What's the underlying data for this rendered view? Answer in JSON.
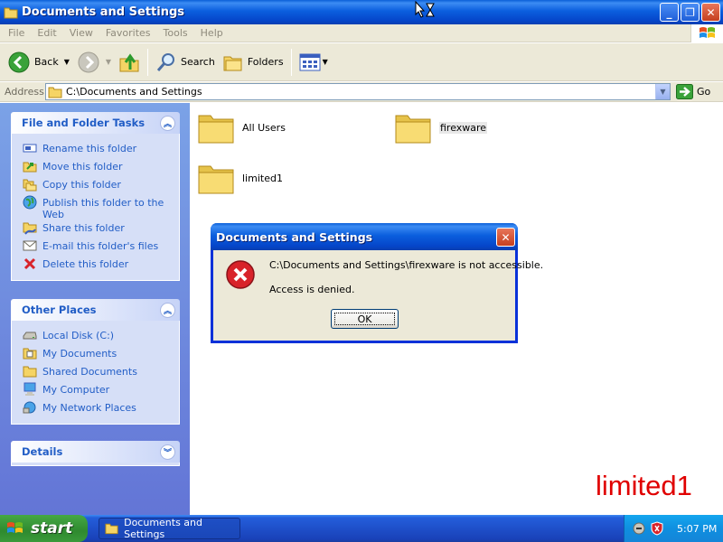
{
  "window": {
    "title": "Documents and Settings"
  },
  "menu": [
    "File",
    "Edit",
    "View",
    "Favorites",
    "Tools",
    "Help"
  ],
  "toolbar": {
    "back": "Back",
    "search": "Search",
    "folders": "Folders"
  },
  "address": {
    "label": "Address",
    "value": "C:\\Documents and Settings",
    "go": "Go"
  },
  "tasks_panel": {
    "title": "File and Folder Tasks",
    "items": [
      {
        "label": "Rename this folder",
        "icon": "rename-icon"
      },
      {
        "label": "Move this folder",
        "icon": "move-icon"
      },
      {
        "label": "Copy this folder",
        "icon": "copy-icon"
      },
      {
        "label": "Publish this folder to the Web",
        "icon": "globe-icon"
      },
      {
        "label": "Share this folder",
        "icon": "share-icon"
      },
      {
        "label": "E-mail this folder's files",
        "icon": "email-icon"
      },
      {
        "label": "Delete this folder",
        "icon": "delete-icon"
      }
    ]
  },
  "places_panel": {
    "title": "Other Places",
    "items": [
      {
        "label": "Local Disk (C:)",
        "icon": "drive-icon"
      },
      {
        "label": "My Documents",
        "icon": "documents-folder-icon"
      },
      {
        "label": "Shared Documents",
        "icon": "shared-folder-icon"
      },
      {
        "label": "My Computer",
        "icon": "computer-icon"
      },
      {
        "label": "My Network Places",
        "icon": "network-icon"
      }
    ]
  },
  "details_panel": {
    "title": "Details"
  },
  "folders": [
    {
      "name": "All Users",
      "selected": false
    },
    {
      "name": "firexware",
      "selected": true
    },
    {
      "name": "limited1",
      "selected": false
    }
  ],
  "watermark": "limited1",
  "dialog": {
    "title": "Documents and Settings",
    "message": "C:\\Documents and Settings\\firexware is not accessible.",
    "detail": "Access is denied.",
    "ok": "OK"
  },
  "taskbar": {
    "start": "start",
    "task": "Documents and Settings",
    "clock": "5:07 PM"
  },
  "colors": {
    "link": "#215dc6",
    "title_bar": "#0a5fd8",
    "watermark": "#e00000",
    "error": "#d8232a"
  }
}
